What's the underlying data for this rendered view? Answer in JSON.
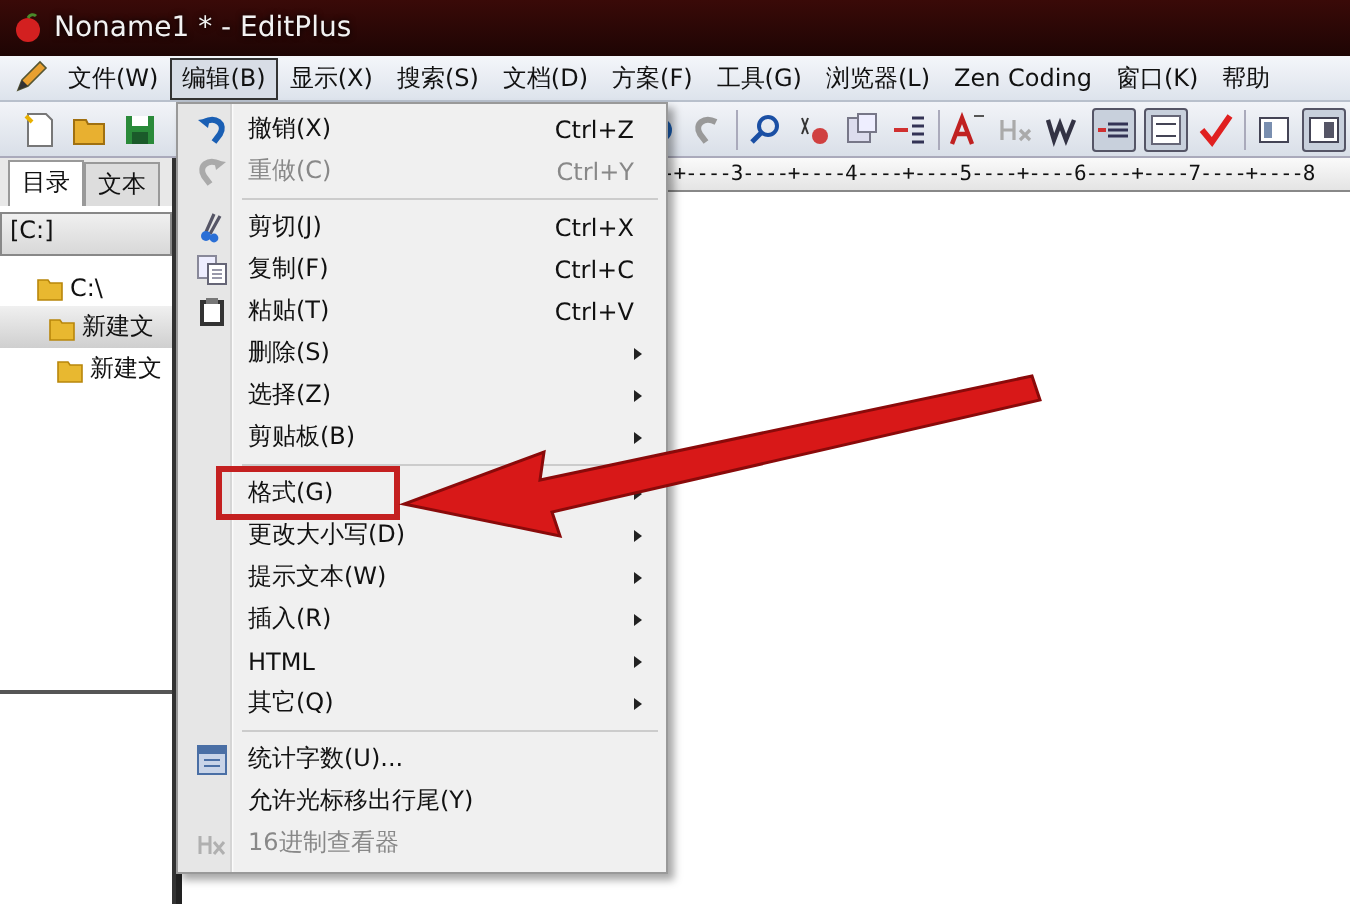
{
  "window": {
    "title": "Noname1 * - EditPlus"
  },
  "menubar": [
    {
      "label": "文件(W)",
      "selected": false
    },
    {
      "label": "编辑(B)",
      "selected": true
    },
    {
      "label": "显示(X)",
      "selected": false
    },
    {
      "label": "搜索(S)",
      "selected": false
    },
    {
      "label": "文档(D)",
      "selected": false
    },
    {
      "label": "方案(F)",
      "selected": false
    },
    {
      "label": "工具(G)",
      "selected": false
    },
    {
      "label": "浏览器(L)",
      "selected": false
    },
    {
      "label": "Zen Coding",
      "selected": false
    },
    {
      "label": "窗口(K)",
      "selected": false
    },
    {
      "label": "帮助",
      "selected": false
    }
  ],
  "sidebar": {
    "tabs": [
      {
        "label": "目录",
        "selected": true
      },
      {
        "label": "文本",
        "selected": false
      }
    ],
    "drive": "[C:]",
    "tree": [
      {
        "label": "C:\\",
        "selected": false,
        "children": [
          {
            "label": "新建文",
            "selected": true,
            "children": [
              {
                "label": "新建文",
                "selected": false
              }
            ]
          }
        ]
      }
    ]
  },
  "ruler": "-+----3----+----4----+----5----+----6----+----7----+----8",
  "menu": {
    "groups": [
      {
        "items": [
          {
            "label": "撤销(X)",
            "shortcut": "Ctrl+Z",
            "kind": "undo",
            "disabled": false,
            "submenu": false,
            "marked": false
          },
          {
            "label": "重做(C)",
            "shortcut": "Ctrl+Y",
            "kind": "redo",
            "disabled": true,
            "submenu": false,
            "marked": false
          }
        ]
      },
      {
        "items": [
          {
            "label": "剪切(J)",
            "shortcut": "Ctrl+X",
            "kind": "cut",
            "disabled": false,
            "submenu": false,
            "marked": false
          },
          {
            "label": "复制(F)",
            "shortcut": "Ctrl+C",
            "kind": "copy",
            "disabled": false,
            "submenu": false,
            "marked": false
          },
          {
            "label": "粘贴(T)",
            "shortcut": "Ctrl+V",
            "kind": "paste",
            "disabled": false,
            "submenu": false,
            "marked": false
          },
          {
            "label": "删除(S)",
            "disabled": false,
            "submenu": true,
            "marked": false
          },
          {
            "label": "选择(Z)",
            "disabled": false,
            "submenu": true,
            "marked": false
          },
          {
            "label": "剪贴板(B)",
            "disabled": false,
            "submenu": true,
            "marked": false
          }
        ]
      },
      {
        "items": [
          {
            "label": "格式(G)",
            "disabled": false,
            "submenu": true,
            "marked": true
          },
          {
            "label": "更改大小写(D)",
            "disabled": false,
            "submenu": true,
            "marked": false
          },
          {
            "label": "提示文本(W)",
            "disabled": false,
            "submenu": true,
            "marked": false
          },
          {
            "label": "插入(R)",
            "disabled": false,
            "submenu": true,
            "marked": false
          },
          {
            "label": "HTML",
            "disabled": false,
            "submenu": true,
            "marked": false
          },
          {
            "label": "其它(Q)",
            "disabled": false,
            "submenu": true,
            "marked": false
          }
        ]
      },
      {
        "items": [
          {
            "label": "统计字数(U)...",
            "kind": "count",
            "disabled": false,
            "submenu": false,
            "marked": false
          },
          {
            "label": "允许光标移出行尾(Y)",
            "disabled": false,
            "submenu": false,
            "marked": false
          },
          {
            "label": "16进制查看器",
            "kind": "hex",
            "disabled": true,
            "submenu": false,
            "marked": false
          }
        ]
      }
    ]
  }
}
